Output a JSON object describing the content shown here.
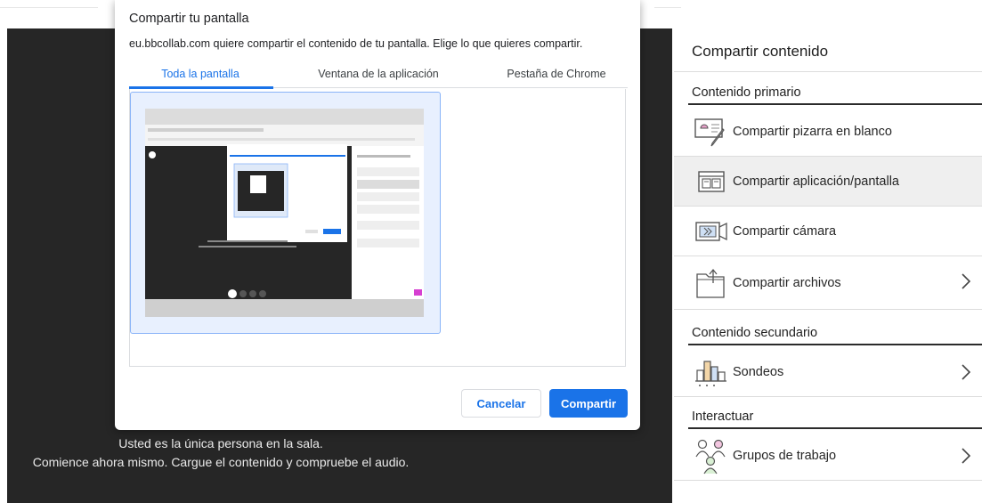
{
  "dialog": {
    "title": "Compartir tu pantalla",
    "subtitle": "eu.bbcollab.com quiere compartir el contenido de tu pantalla. Elige lo que quieres compartir.",
    "tabs": [
      "Toda la pantalla",
      "Ventana de la aplicación",
      "Pestaña de Chrome"
    ],
    "active_tab": 0,
    "cancel_label": "Cancelar",
    "share_label": "Compartir"
  },
  "stage": {
    "line1": "Usted es la única persona en la sala.",
    "line2": "Comience ahora mismo. Cargue el contenido y compruebe el audio."
  },
  "panel": {
    "title": "Compartir contenido",
    "primary_title": "Contenido primario",
    "items": [
      {
        "label": "Compartir pizarra en blanco",
        "icon": "whiteboard-icon"
      },
      {
        "label": "Compartir aplicación/pantalla",
        "icon": "screen-share-icon"
      },
      {
        "label": "Compartir cámara",
        "icon": "camera-icon"
      },
      {
        "label": "Compartir archivos",
        "icon": "folder-icon"
      }
    ],
    "secondary_title": "Contenido secundario",
    "secondary_items": [
      {
        "label": "Sondeos",
        "icon": "polls-icon"
      }
    ],
    "interact_title": "Interactuar",
    "interact_items": [
      {
        "label": "Grupos de trabajo",
        "icon": "breakout-groups-icon"
      }
    ]
  },
  "colors": {
    "accent": "#1a73e8",
    "stage_bg": "#262626",
    "active_row": "#efefef"
  }
}
